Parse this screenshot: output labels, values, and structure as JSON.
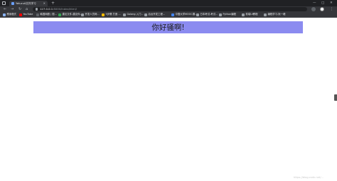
{
  "browser": {
    "tab": {
      "title": "Yetucuit文件学习"
    },
    "new_tab": "+",
    "window_controls": {
      "minimize": "—",
      "maximize": "□",
      "close": "✕"
    },
    "address": {
      "host": "127.0.0.1",
      "path": ":8000/index/html/"
    }
  },
  "bookmarks": [
    {
      "label": "應用程式",
      "color": "#8ab4f8"
    },
    {
      "label": "YouTube",
      "color": "#ff0000"
    },
    {
      "label": "韩国网剧 | 剧...",
      "color": "#5f6368"
    },
    {
      "label": "建议文件-建议你...",
      "color": "#34a853"
    },
    {
      "label": "开发人员网...",
      "color": "#9aa0a6"
    },
    {
      "label": "5步骤 打造 ...",
      "color": "#fbbc04"
    },
    {
      "label": "Golang 入门...",
      "color": "#9aa0a6"
    },
    {
      "label": "后台开发工程...",
      "color": "#9aa0a6"
    },
    {
      "label": "中国大学MOOC课...",
      "color": "#4285f4"
    },
    {
      "label": "日本考试-考试...",
      "color": "#9aa0a6"
    },
    {
      "label": "Python编程",
      "color": "#9aa0a6"
    },
    {
      "label": "前端UI教程",
      "color": "#9aa0a6"
    },
    {
      "label": "编程学习-阮一峰",
      "color": "#9aa0a6"
    }
  ],
  "page": {
    "greeting": "你好骚啊!",
    "banner_color": "#8b8bf0",
    "watermark": "https://blog.csdn.net/..."
  }
}
